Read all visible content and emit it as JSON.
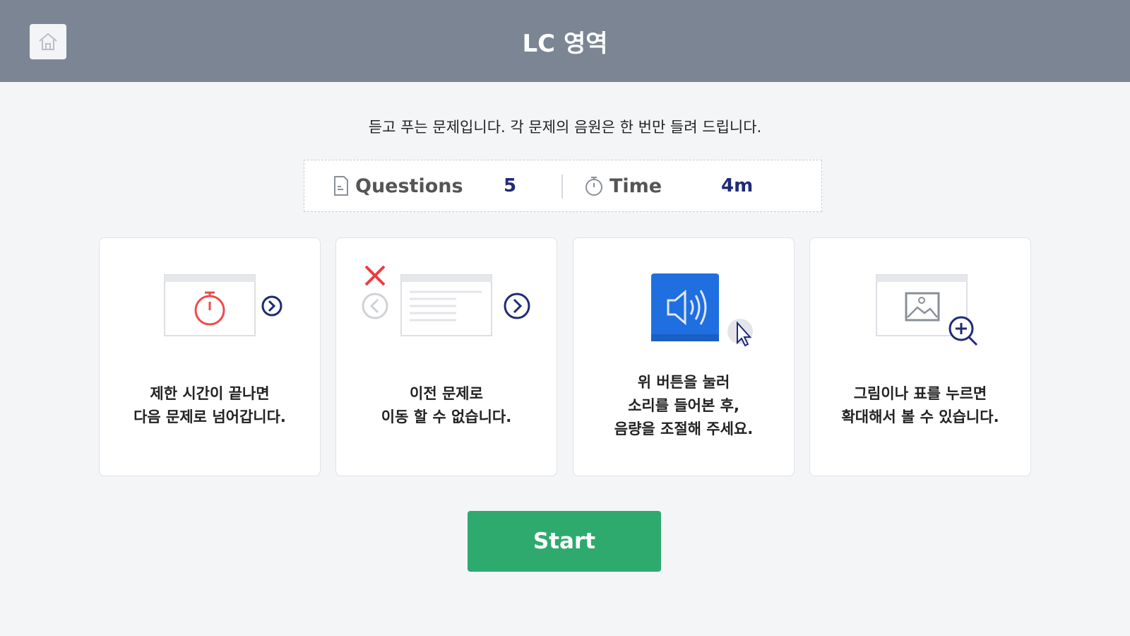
{
  "header": {
    "title": "LC 영역",
    "home_icon": "home-icon"
  },
  "instruction": "듣고 푸는 문제입니다. 각 문제의 음원은 한 번만 들려 드립니다.",
  "info": {
    "questions_label": "Questions",
    "questions_value": "5",
    "time_label": "Time",
    "time_value": "4m"
  },
  "cards": [
    {
      "icon": "timer-next-icon",
      "lines": [
        "제한 시간이 끝나면",
        "다음 문제로 넘어갑니다."
      ]
    },
    {
      "icon": "no-previous-icon",
      "lines": [
        "이전 문제로",
        "이동 할 수 없습니다."
      ]
    },
    {
      "icon": "volume-button-icon",
      "lines": [
        "위 버튼을 눌러",
        "소리를 들어본 후,",
        "음량을 조절해 주세요."
      ]
    },
    {
      "icon": "zoom-image-icon",
      "lines": [
        "그림이나 표를 누르면",
        "확대해서 볼 수 있습니다."
      ]
    }
  ],
  "start_label": "Start",
  "colors": {
    "header_bg": "#7b8593",
    "start_bg": "#2faa6f",
    "accent_navy": "#1f2a78",
    "timer_red": "#ef4b4b",
    "volume_blue": "#1f6fe0"
  }
}
